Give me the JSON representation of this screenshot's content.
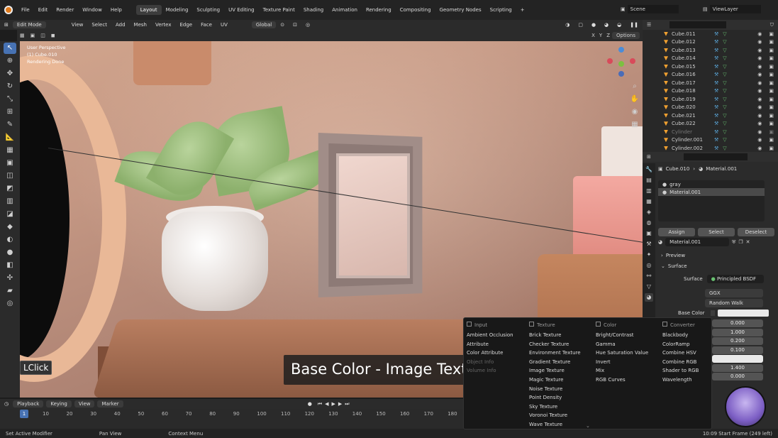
{
  "menu": [
    "File",
    "Edit",
    "Render",
    "Window",
    "Help"
  ],
  "workspaces": [
    "Layout",
    "Modeling",
    "Sculpting",
    "UV Editing",
    "Texture Paint",
    "Shading",
    "Animation",
    "Rendering",
    "Compositing",
    "Geometry Nodes",
    "Scripting"
  ],
  "active_workspace": "Layout",
  "scene": "Scene",
  "view_layer": "ViewLayer",
  "viewport_header": {
    "mode": "Edit Mode",
    "items": [
      "View",
      "Select",
      "Add",
      "Mesh",
      "Vertex",
      "Edge",
      "Face",
      "UV"
    ],
    "transform": "Global",
    "options": "Options",
    "axes": [
      "X",
      "Y",
      "Z"
    ]
  },
  "viewport_info": {
    "line1": "User Perspective",
    "line2": "(1) Cube.010",
    "line3": "Rendering Done"
  },
  "lclick": "LClick",
  "caption": "Base Color - Image Texture",
  "timeline": {
    "items": [
      "Playback",
      "Keying",
      "View",
      "Marker"
    ],
    "current_frame": "1",
    "ticks": [
      "10",
      "20",
      "30",
      "40",
      "50",
      "60",
      "70",
      "80",
      "90",
      "100",
      "110",
      "120",
      "130",
      "140",
      "150",
      "160",
      "170",
      "180"
    ]
  },
  "statusbar": {
    "left": "Set Active Modifier",
    "mid": "Pan View",
    "right": "Context Menu",
    "info": "10:09 Start Frame (249 left)"
  },
  "outliner": {
    "rows": [
      {
        "label": "Cube.011",
        "dim": false
      },
      {
        "label": "Cube.012",
        "dim": false
      },
      {
        "label": "Cube.013",
        "dim": false
      },
      {
        "label": "Cube.014",
        "dim": false
      },
      {
        "label": "Cube.015",
        "dim": false
      },
      {
        "label": "Cube.016",
        "dim": false
      },
      {
        "label": "Cube.017",
        "dim": false
      },
      {
        "label": "Cube.018",
        "dim": false
      },
      {
        "label": "Cube.019",
        "dim": false
      },
      {
        "label": "Cube.020",
        "dim": false
      },
      {
        "label": "Cube.021",
        "dim": false
      },
      {
        "label": "Cube.022",
        "dim": false
      },
      {
        "label": "Cylinder",
        "dim": true
      },
      {
        "label": "Cylinder.001",
        "dim": false
      },
      {
        "label": "Cylinder.002",
        "dim": false
      }
    ]
  },
  "properties": {
    "breadcrumb_object": "Cube.010",
    "breadcrumb_material": "Material.001",
    "slots": [
      "gray",
      "Material.001"
    ],
    "assign": "Assign",
    "select": "Select",
    "deselect": "Deselect",
    "material_name": "Material.001",
    "preview": "Preview",
    "surface_section": "Surface",
    "surface_label": "Surface",
    "surface_value": "Principled BSDF",
    "distribution": "GGX",
    "subsurface_method": "Random Walk",
    "base_color_label": "Base Color",
    "values": [
      "0.000",
      "1.000",
      "0.200",
      "0.100",
      "",
      "1.400",
      "0.000"
    ]
  },
  "popup": {
    "columns": [
      {
        "head": "Input",
        "items": [
          {
            "t": "Ambient Occlusion",
            "dim": false
          },
          {
            "t": "Attribute",
            "dim": false
          },
          {
            "t": "Color Attribute",
            "dim": false
          },
          {
            "t": "Object Info",
            "dim": true
          },
          {
            "t": "Volume Info",
            "dim": true
          }
        ]
      },
      {
        "head": "Texture",
        "items": [
          {
            "t": "Brick Texture",
            "dim": false
          },
          {
            "t": "Checker Texture",
            "dim": false
          },
          {
            "t": "Environment Texture",
            "dim": false
          },
          {
            "t": "Gradient Texture",
            "dim": false
          },
          {
            "t": "Image Texture",
            "dim": false
          },
          {
            "t": "Magic Texture",
            "dim": false
          },
          {
            "t": "Noise Texture",
            "dim": false
          },
          {
            "t": "Point Density",
            "dim": false
          },
          {
            "t": "Sky Texture",
            "dim": false
          },
          {
            "t": "Voronoi Texture",
            "dim": false
          },
          {
            "t": "Wave Texture",
            "dim": false
          }
        ]
      },
      {
        "head": "Color",
        "items": [
          {
            "t": "Bright/Contrast",
            "dim": false
          },
          {
            "t": "Gamma",
            "dim": false
          },
          {
            "t": "Hue Saturation Value",
            "dim": false
          },
          {
            "t": "Invert",
            "dim": false
          },
          {
            "t": "Mix",
            "dim": false
          },
          {
            "t": "RGB Curves",
            "dim": false
          }
        ]
      },
      {
        "head": "Converter",
        "items": [
          {
            "t": "Blackbody",
            "dim": false
          },
          {
            "t": "ColorRamp",
            "dim": false
          },
          {
            "t": "Combine HSV",
            "dim": false
          },
          {
            "t": "Combine RGB",
            "dim": false
          },
          {
            "t": "Shader to RGB",
            "dim": false
          },
          {
            "t": "Wavelength",
            "dim": false
          }
        ]
      }
    ]
  },
  "colors": {
    "accent": "#4772b3",
    "object_orange": "#f0a030"
  }
}
